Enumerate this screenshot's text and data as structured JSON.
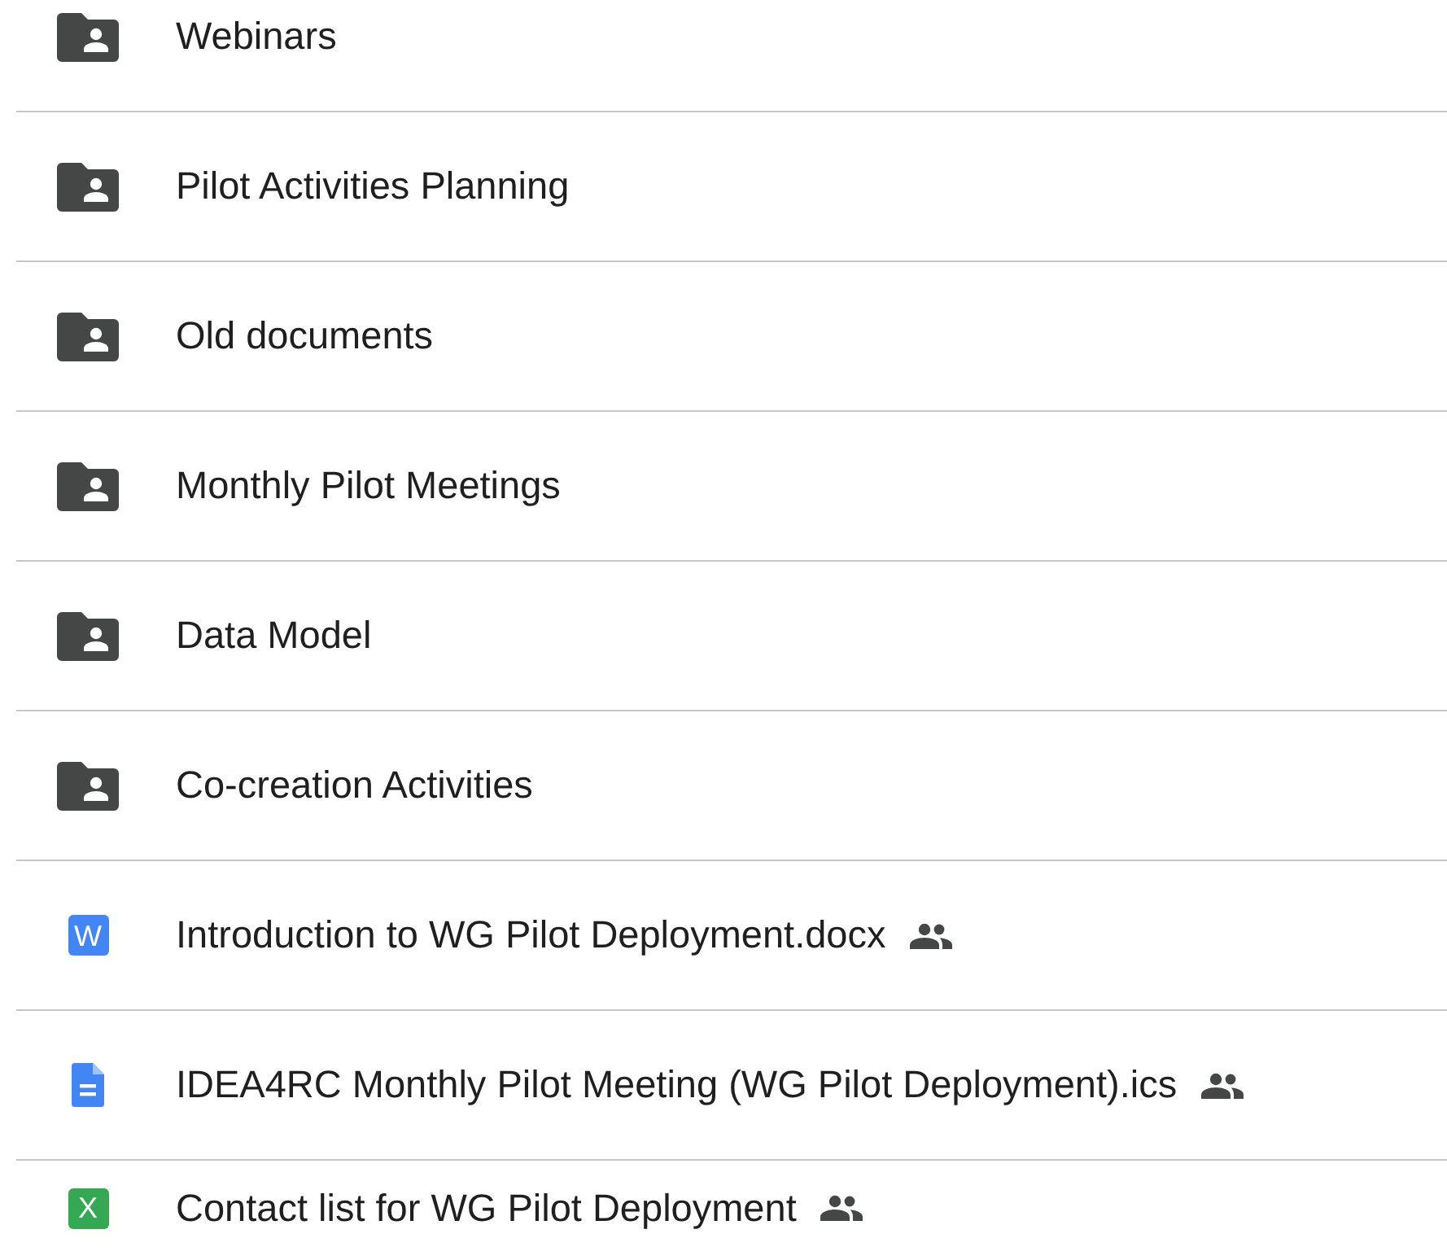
{
  "items": [
    {
      "kind": "folder",
      "name": "Webinars"
    },
    {
      "kind": "folder",
      "name": "Pilot Activities Planning"
    },
    {
      "kind": "folder",
      "name": "Old documents"
    },
    {
      "kind": "folder",
      "name": "Monthly Pilot Meetings"
    },
    {
      "kind": "folder",
      "name": "Data Model"
    },
    {
      "kind": "folder",
      "name": "Co-creation Activities"
    },
    {
      "kind": "word",
      "badge": "W",
      "name": "Introduction to WG Pilot Deployment.docx",
      "shared": true
    },
    {
      "kind": "doc",
      "name": "IDEA4RC Monthly Pilot Meeting (WG Pilot Deployment).ics",
      "shared": true
    },
    {
      "kind": "sheet",
      "badge": "X",
      "name": "Contact list for WG Pilot Deployment",
      "shared": true
    }
  ]
}
